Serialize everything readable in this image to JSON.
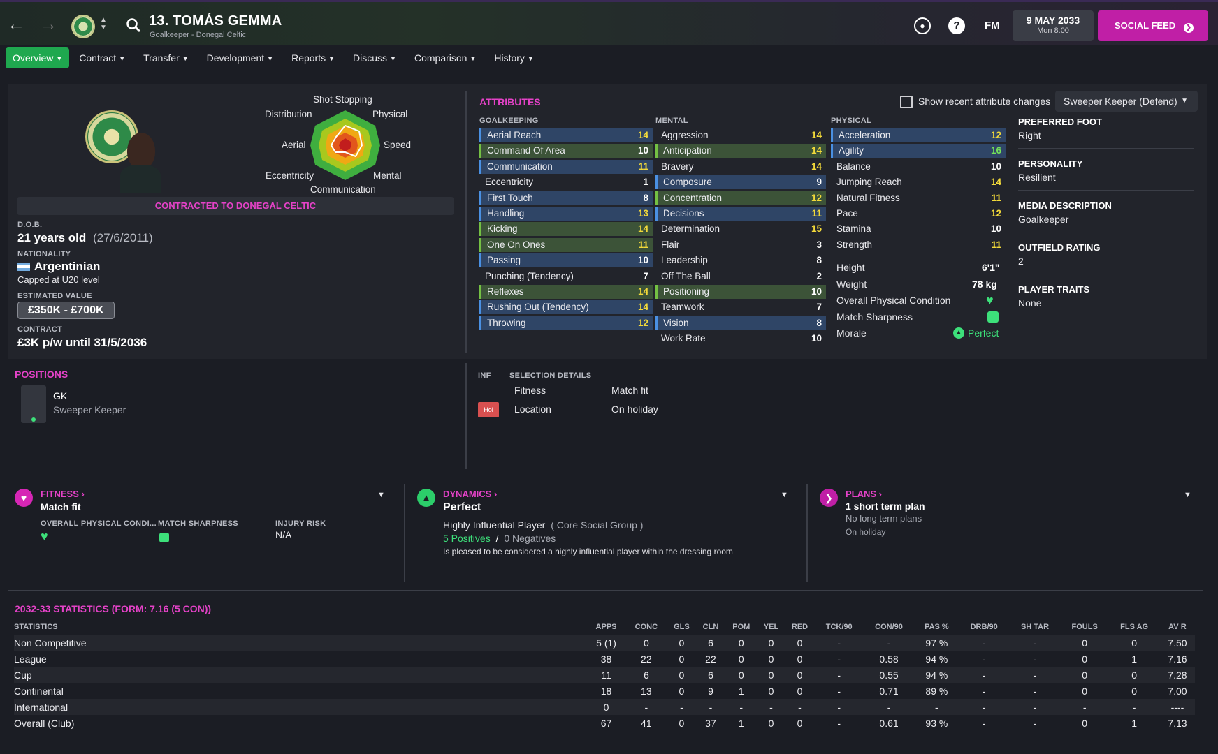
{
  "header": {
    "title": "13. TOMÁS GEMMA",
    "subtitle": "Goalkeeper - Donegal Celtic",
    "fm_label": "FM",
    "date": "9 MAY 2033",
    "time": "Mon 8:00",
    "social_feed": "SOCIAL FEED"
  },
  "tabs": [
    "Overview",
    "Contract",
    "Transfer",
    "Development",
    "Reports",
    "Discuss",
    "Comparison",
    "History"
  ],
  "profile": {
    "radar_labels": {
      "top": "Shot Stopping",
      "top_left": "Distribution",
      "top_right": "Physical",
      "left": "Aerial",
      "right": "Speed",
      "bottom_left": "Eccentricity",
      "bottom_right": "Mental",
      "bottom": "Communication"
    },
    "contract_banner": "CONTRACTED TO DONEGAL CELTIC",
    "dob_label": "D.O.B.",
    "age": "21 years old",
    "dob": "(27/6/2011)",
    "nationality_label": "NATIONALITY",
    "nationality": "Argentinian",
    "capped": "Capped at U20 level",
    "value_label": "ESTIMATED VALUE",
    "value": "£350K - £700K",
    "contract_label": "CONTRACT",
    "contract": "£3K p/w until 31/5/2036"
  },
  "attributes": {
    "title": "ATTRIBUTES",
    "show_changes": "Show recent attribute changes",
    "role": "Sweeper Keeper (Defend)",
    "goalkeeping_label": "GOALKEEPING",
    "mental_label": "MENTAL",
    "physical_label": "PHYSICAL",
    "goalkeeping": [
      {
        "name": "Aerial Reach",
        "value": "14",
        "hl": "blue"
      },
      {
        "name": "Command Of Area",
        "value": "10",
        "hl": "green"
      },
      {
        "name": "Communication",
        "value": "11",
        "hl": "blue"
      },
      {
        "name": "Eccentricity",
        "value": "1",
        "hl": ""
      },
      {
        "name": "First Touch",
        "value": "8",
        "hl": "blue"
      },
      {
        "name": "Handling",
        "value": "13",
        "hl": "blue"
      },
      {
        "name": "Kicking",
        "value": "14",
        "hl": "green"
      },
      {
        "name": "One On Ones",
        "value": "11",
        "hl": "green"
      },
      {
        "name": "Passing",
        "value": "10",
        "hl": "blue"
      },
      {
        "name": "Punching (Tendency)",
        "value": "7",
        "hl": ""
      },
      {
        "name": "Reflexes",
        "value": "14",
        "hl": "green"
      },
      {
        "name": "Rushing Out (Tendency)",
        "value": "14",
        "hl": "blue"
      },
      {
        "name": "Throwing",
        "value": "12",
        "hl": "blue"
      }
    ],
    "mental": [
      {
        "name": "Aggression",
        "value": "14",
        "hl": ""
      },
      {
        "name": "Anticipation",
        "value": "14",
        "hl": "green"
      },
      {
        "name": "Bravery",
        "value": "14",
        "hl": ""
      },
      {
        "name": "Composure",
        "value": "9",
        "hl": "blue"
      },
      {
        "name": "Concentration",
        "value": "12",
        "hl": "green"
      },
      {
        "name": "Decisions",
        "value": "11",
        "hl": "blue"
      },
      {
        "name": "Determination",
        "value": "15",
        "hl": ""
      },
      {
        "name": "Flair",
        "value": "3",
        "hl": ""
      },
      {
        "name": "Leadership",
        "value": "8",
        "hl": ""
      },
      {
        "name": "Off The Ball",
        "value": "2",
        "hl": ""
      },
      {
        "name": "Positioning",
        "value": "10",
        "hl": "green"
      },
      {
        "name": "Teamwork",
        "value": "7",
        "hl": ""
      },
      {
        "name": "Vision",
        "value": "8",
        "hl": "blue"
      },
      {
        "name": "Work Rate",
        "value": "10",
        "hl": ""
      }
    ],
    "physical": [
      {
        "name": "Acceleration",
        "value": "12",
        "hl": "blue"
      },
      {
        "name": "Agility",
        "value": "16",
        "hl": "blue"
      },
      {
        "name": "Balance",
        "value": "10",
        "hl": ""
      },
      {
        "name": "Jumping Reach",
        "value": "14",
        "hl": ""
      },
      {
        "name": "Natural Fitness",
        "value": "11",
        "hl": ""
      },
      {
        "name": "Pace",
        "value": "12",
        "hl": ""
      },
      {
        "name": "Stamina",
        "value": "10",
        "hl": ""
      },
      {
        "name": "Strength",
        "value": "11",
        "hl": ""
      }
    ],
    "extras": {
      "height_label": "Height",
      "height": "6'1\"",
      "weight_label": "Weight",
      "weight": "78 kg",
      "opc_label": "Overall Physical Condition",
      "sharpness_label": "Match Sharpness",
      "morale_label": "Morale",
      "morale": "Perfect"
    }
  },
  "info": {
    "foot_label": "PREFERRED FOOT",
    "foot": "Right",
    "personality_label": "PERSONALITY",
    "personality": "Resilient",
    "media_label": "MEDIA DESCRIPTION",
    "media": "Goalkeeper",
    "outfield_label": "OUTFIELD RATING",
    "outfield": "2",
    "traits_label": "PLAYER TRAITS",
    "traits": "None"
  },
  "positions": {
    "title": "POSITIONS",
    "pos": "GK",
    "role": "Sweeper Keeper"
  },
  "selection": {
    "inf_label": "INF",
    "details_label": "SELECTION DETAILS",
    "rows": [
      {
        "badge": "",
        "label": "Fitness",
        "value": "Match fit"
      },
      {
        "badge": "Hol",
        "label": "Location",
        "value": "On holiday"
      }
    ]
  },
  "fitness": {
    "title": "FITNESS",
    "status": "Match fit",
    "opc_label": "OVERALL PHYSICAL CONDI...",
    "sharpness_label": "MATCH SHARPNESS",
    "injury_label": "INJURY RISK",
    "injury": "N/A"
  },
  "dynamics": {
    "title": "DYNAMICS",
    "status": "Perfect",
    "influence": "Highly Influential Player",
    "group": "( Core Social Group )",
    "positives": "5 Positives",
    "sep": "/",
    "negatives": "0 Negatives",
    "note": "Is pleased to be considered a highly influential player within the dressing room"
  },
  "plans": {
    "title": "PLANS",
    "short": "1 short term plan",
    "long": "No long term plans",
    "note": "On holiday"
  },
  "stats": {
    "title": "2032-33 STATISTICS (FORM: 7.16 (5 CON))",
    "columns": [
      "STATISTICS",
      "APPS",
      "CONC",
      "GLS",
      "CLN",
      "POM",
      "YEL",
      "RED",
      "TCK/90",
      "CON/90",
      "PAS %",
      "DRB/90",
      "SH TAR",
      "FOULS",
      "FLS AG",
      "AV R"
    ],
    "rows": [
      [
        "Non Competitive",
        "5 (1)",
        "0",
        "0",
        "6",
        "0",
        "0",
        "0",
        "-",
        "-",
        "97 %",
        "-",
        "-",
        "0",
        "0",
        "7.50"
      ],
      [
        "League",
        "38",
        "22",
        "0",
        "22",
        "0",
        "0",
        "0",
        "-",
        "0.58",
        "94 %",
        "-",
        "-",
        "0",
        "1",
        "7.16"
      ],
      [
        "Cup",
        "11",
        "6",
        "0",
        "6",
        "0",
        "0",
        "0",
        "-",
        "0.55",
        "94 %",
        "-",
        "-",
        "0",
        "0",
        "7.28"
      ],
      [
        "Continental",
        "18",
        "13",
        "0",
        "9",
        "1",
        "0",
        "0",
        "-",
        "0.71",
        "89 %",
        "-",
        "-",
        "0",
        "0",
        "7.00"
      ],
      [
        "International",
        "0",
        "-",
        "-",
        "-",
        "-",
        "-",
        "-",
        "-",
        "-",
        "-",
        "-",
        "-",
        "-",
        "-",
        "----"
      ],
      [
        "Overall (Club)",
        "67",
        "41",
        "0",
        "37",
        "1",
        "0",
        "0",
        "-",
        "0.61",
        "93 %",
        "-",
        "-",
        "0",
        "1",
        "7.13"
      ]
    ]
  },
  "colors": {
    "accent_pink": "#e542c8",
    "accent_green": "#1fa84f",
    "value_yellow": "#f2d93a",
    "value_green": "#74e05a",
    "social_purple": "#c01fa6"
  }
}
